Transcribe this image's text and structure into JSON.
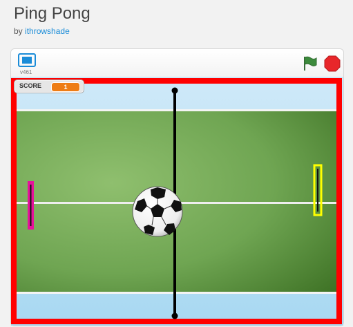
{
  "project": {
    "title": "Ping Pong",
    "by_prefix": "by",
    "author": "ithrowshade"
  },
  "player": {
    "version": "v461",
    "fullscreen_icon": "fullscreen-icon",
    "green_flag_icon": "green-flag-icon",
    "stop_icon": "stop-sign-icon"
  },
  "score_monitor": {
    "label": "SCORE",
    "value": "1"
  },
  "colors": {
    "border_frame": "#ff0000",
    "left_paddle": "#e6139b",
    "right_paddle": "#ffff00",
    "score_value_bg": "#ee7d16",
    "flag_green": "#3c8a3c",
    "stop_red": "#e8262a",
    "author_link": "#1a8cd8"
  }
}
